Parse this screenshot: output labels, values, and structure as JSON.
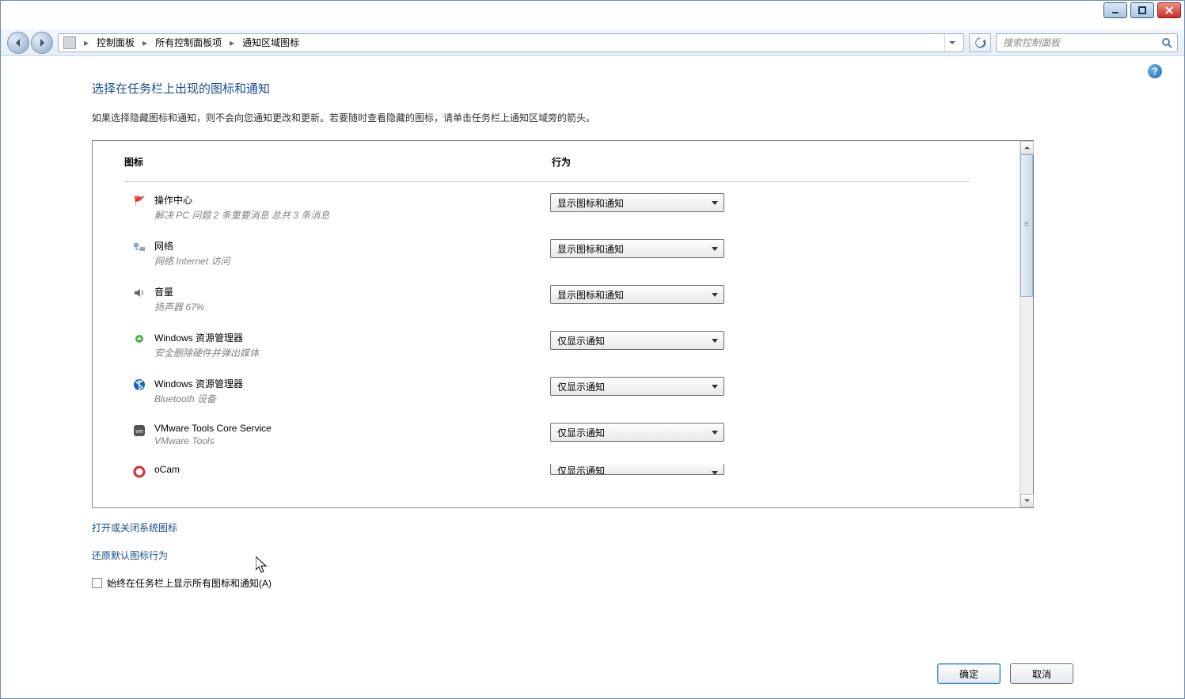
{
  "window": {
    "minimize_tooltip": "最小化",
    "maximize_tooltip": "最大化",
    "close_tooltip": "关闭"
  },
  "breadcrumb": {
    "root": "控制面板",
    "mid": "所有控制面板项",
    "leaf": "通知区域图标"
  },
  "search": {
    "placeholder": "搜索控制面板"
  },
  "page": {
    "title": "选择在任务栏上出现的图标和通知",
    "description": "如果选择隐藏图标和通知，则不会向您通知更改和更新。若要随时查看隐藏的图标，请单击任务栏上通知区域旁的箭头。"
  },
  "columns": {
    "icon": "图标",
    "behaviour": "行为"
  },
  "behaviour_options": {
    "show_all": "显示图标和通知",
    "notify_only": "仅显示通知"
  },
  "items": [
    {
      "icon": "action-center-icon",
      "title": "操作中心",
      "subtitle": "解决 PC 问题  2 条重要消息 总共 3 条消息",
      "behaviour": "show_all"
    },
    {
      "icon": "network-icon",
      "title": "网络",
      "subtitle": "网络 Internet 访问",
      "behaviour": "show_all"
    },
    {
      "icon": "volume-icon",
      "title": "音量",
      "subtitle": "扬声器 67%",
      "behaviour": "show_all"
    },
    {
      "icon": "eject-icon",
      "title": "Windows 资源管理器",
      "subtitle": "安全删除硬件并弹出媒体",
      "behaviour": "notify_only"
    },
    {
      "icon": "bluetooth-icon",
      "title": "Windows 资源管理器",
      "subtitle": "Bluetooth 设备",
      "behaviour": "notify_only"
    },
    {
      "icon": "vmware-icon",
      "title": "VMware Tools Core Service",
      "subtitle": "VMware Tools",
      "behaviour": "notify_only"
    },
    {
      "icon": "ocam-icon",
      "title": "oCam",
      "subtitle": "",
      "behaviour": "notify_only"
    }
  ],
  "links": {
    "system_icons": "打开或关闭系统图标",
    "restore_defaults": "还原默认图标行为"
  },
  "checkbox": {
    "label": "始终在任务栏上显示所有图标和通知(A)",
    "checked": false
  },
  "buttons": {
    "ok": "确定",
    "cancel": "取消"
  }
}
